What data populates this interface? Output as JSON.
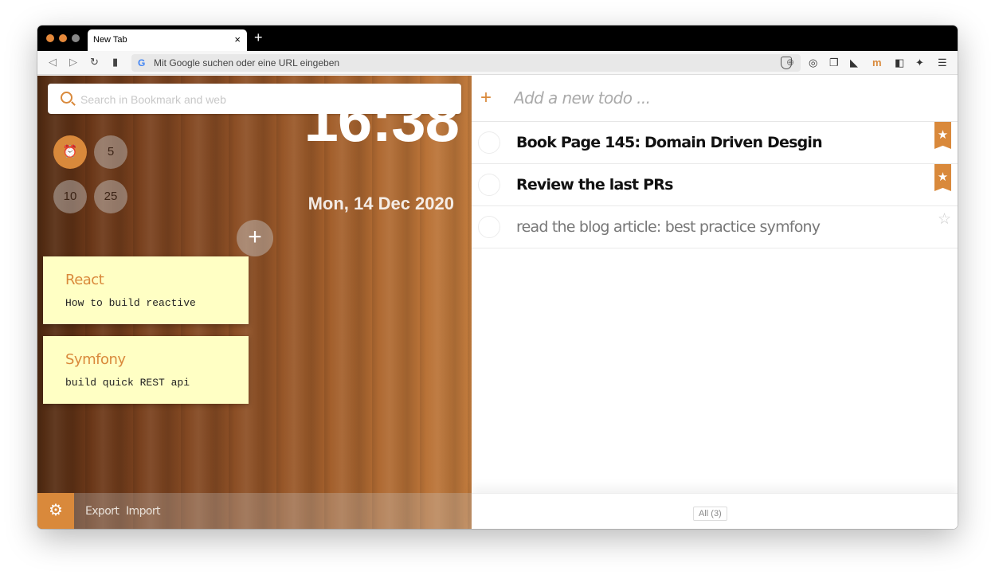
{
  "browser": {
    "tab_title": "New Tab",
    "tab_close": "×",
    "new_tab": "+",
    "url_placeholder": "Mit Google suchen oder eine URL eingeben",
    "search_engine_icon": "G"
  },
  "search": {
    "placeholder": "Search in Bookmark and web"
  },
  "timers": {
    "presets": [
      "5",
      "10",
      "25"
    ]
  },
  "clock": {
    "time": "16:38",
    "date": "Mon, 14 Dec 2020"
  },
  "notes": [
    {
      "title": "React",
      "body": "How to build reactive"
    },
    {
      "title": "Symfony",
      "body": "build quick REST api"
    }
  ],
  "add_note": "+",
  "footer": {
    "export": "Export",
    "import": "Import"
  },
  "todo": {
    "add_plus": "+",
    "add_placeholder": "Add a new todo ...",
    "items": [
      {
        "text": "Book Page 145: Domain Driven Desgin",
        "starred": true
      },
      {
        "text": "Review the last PRs",
        "starred": true
      },
      {
        "text": "read the blog article: best practice symfony",
        "starred": false
      }
    ],
    "filter": "All (3)"
  },
  "colors": {
    "accent": "#d9893b",
    "note_bg": "#ffffc4"
  }
}
